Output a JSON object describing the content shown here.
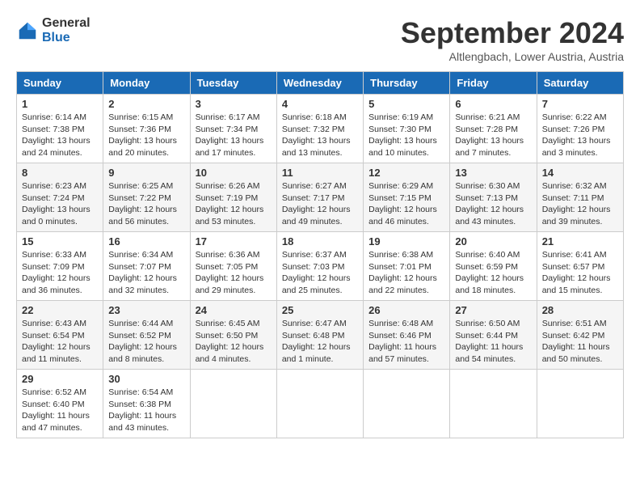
{
  "logo": {
    "general": "General",
    "blue": "Blue"
  },
  "title": {
    "month_year": "September 2024",
    "location": "Altlengbach, Lower Austria, Austria"
  },
  "headers": [
    "Sunday",
    "Monday",
    "Tuesday",
    "Wednesday",
    "Thursday",
    "Friday",
    "Saturday"
  ],
  "weeks": [
    [
      {
        "day": "1",
        "sunrise": "6:14 AM",
        "sunset": "7:38 PM",
        "daylight": "13 hours and 24 minutes."
      },
      {
        "day": "2",
        "sunrise": "6:15 AM",
        "sunset": "7:36 PM",
        "daylight": "13 hours and 20 minutes."
      },
      {
        "day": "3",
        "sunrise": "6:17 AM",
        "sunset": "7:34 PM",
        "daylight": "13 hours and 17 minutes."
      },
      {
        "day": "4",
        "sunrise": "6:18 AM",
        "sunset": "7:32 PM",
        "daylight": "13 hours and 13 minutes."
      },
      {
        "day": "5",
        "sunrise": "6:19 AM",
        "sunset": "7:30 PM",
        "daylight": "13 hours and 10 minutes."
      },
      {
        "day": "6",
        "sunrise": "6:21 AM",
        "sunset": "7:28 PM",
        "daylight": "13 hours and 7 minutes."
      },
      {
        "day": "7",
        "sunrise": "6:22 AM",
        "sunset": "7:26 PM",
        "daylight": "13 hours and 3 minutes."
      }
    ],
    [
      {
        "day": "8",
        "sunrise": "6:23 AM",
        "sunset": "7:24 PM",
        "daylight": "13 hours and 0 minutes."
      },
      {
        "day": "9",
        "sunrise": "6:25 AM",
        "sunset": "7:22 PM",
        "daylight": "12 hours and 56 minutes."
      },
      {
        "day": "10",
        "sunrise": "6:26 AM",
        "sunset": "7:19 PM",
        "daylight": "12 hours and 53 minutes."
      },
      {
        "day": "11",
        "sunrise": "6:27 AM",
        "sunset": "7:17 PM",
        "daylight": "12 hours and 49 minutes."
      },
      {
        "day": "12",
        "sunrise": "6:29 AM",
        "sunset": "7:15 PM",
        "daylight": "12 hours and 46 minutes."
      },
      {
        "day": "13",
        "sunrise": "6:30 AM",
        "sunset": "7:13 PM",
        "daylight": "12 hours and 43 minutes."
      },
      {
        "day": "14",
        "sunrise": "6:32 AM",
        "sunset": "7:11 PM",
        "daylight": "12 hours and 39 minutes."
      }
    ],
    [
      {
        "day": "15",
        "sunrise": "6:33 AM",
        "sunset": "7:09 PM",
        "daylight": "12 hours and 36 minutes."
      },
      {
        "day": "16",
        "sunrise": "6:34 AM",
        "sunset": "7:07 PM",
        "daylight": "12 hours and 32 minutes."
      },
      {
        "day": "17",
        "sunrise": "6:36 AM",
        "sunset": "7:05 PM",
        "daylight": "12 hours and 29 minutes."
      },
      {
        "day": "18",
        "sunrise": "6:37 AM",
        "sunset": "7:03 PM",
        "daylight": "12 hours and 25 minutes."
      },
      {
        "day": "19",
        "sunrise": "6:38 AM",
        "sunset": "7:01 PM",
        "daylight": "12 hours and 22 minutes."
      },
      {
        "day": "20",
        "sunrise": "6:40 AM",
        "sunset": "6:59 PM",
        "daylight": "12 hours and 18 minutes."
      },
      {
        "day": "21",
        "sunrise": "6:41 AM",
        "sunset": "6:57 PM",
        "daylight": "12 hours and 15 minutes."
      }
    ],
    [
      {
        "day": "22",
        "sunrise": "6:43 AM",
        "sunset": "6:54 PM",
        "daylight": "12 hours and 11 minutes."
      },
      {
        "day": "23",
        "sunrise": "6:44 AM",
        "sunset": "6:52 PM",
        "daylight": "12 hours and 8 minutes."
      },
      {
        "day": "24",
        "sunrise": "6:45 AM",
        "sunset": "6:50 PM",
        "daylight": "12 hours and 4 minutes."
      },
      {
        "day": "25",
        "sunrise": "6:47 AM",
        "sunset": "6:48 PM",
        "daylight": "12 hours and 1 minute."
      },
      {
        "day": "26",
        "sunrise": "6:48 AM",
        "sunset": "6:46 PM",
        "daylight": "11 hours and 57 minutes."
      },
      {
        "day": "27",
        "sunrise": "6:50 AM",
        "sunset": "6:44 PM",
        "daylight": "11 hours and 54 minutes."
      },
      {
        "day": "28",
        "sunrise": "6:51 AM",
        "sunset": "6:42 PM",
        "daylight": "11 hours and 50 minutes."
      }
    ],
    [
      {
        "day": "29",
        "sunrise": "6:52 AM",
        "sunset": "6:40 PM",
        "daylight": "11 hours and 47 minutes."
      },
      {
        "day": "30",
        "sunrise": "6:54 AM",
        "sunset": "6:38 PM",
        "daylight": "11 hours and 43 minutes."
      },
      null,
      null,
      null,
      null,
      null
    ]
  ]
}
